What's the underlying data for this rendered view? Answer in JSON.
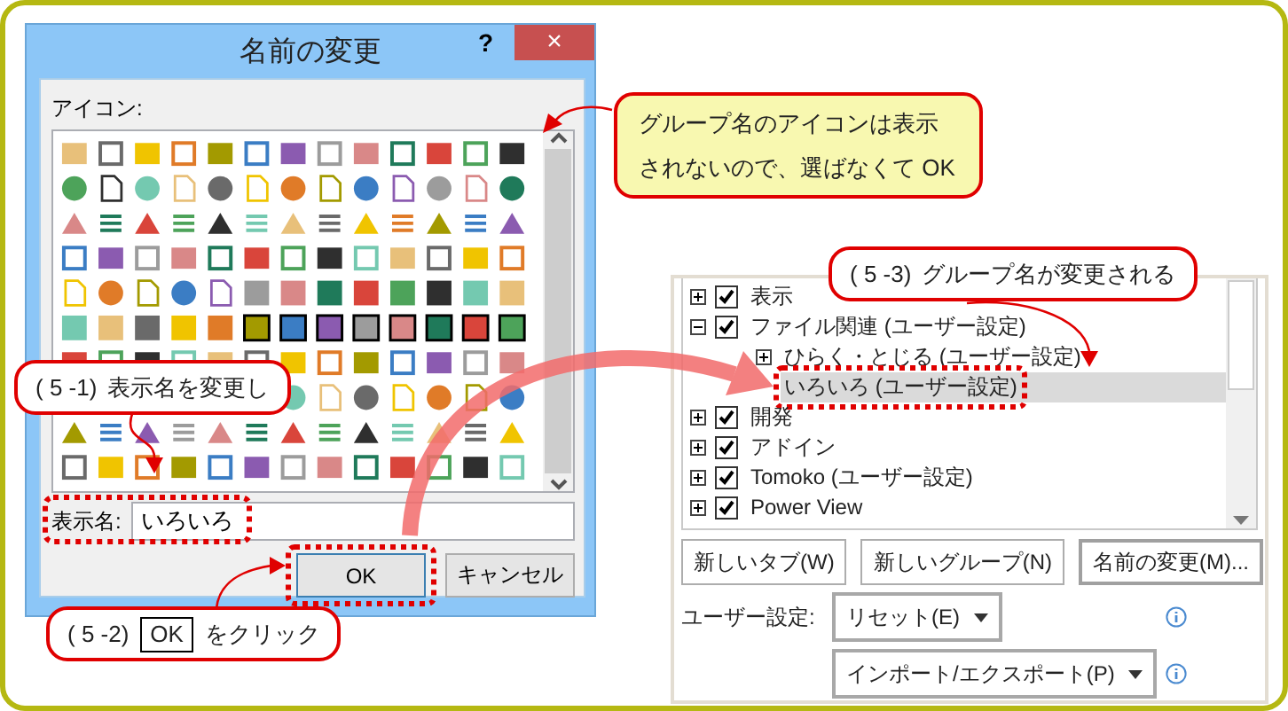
{
  "dialog": {
    "title": "名前の変更",
    "help_button": "?",
    "close_button": "×",
    "icon_label": "アイコン:",
    "name_label": "表示名:",
    "name_value": "いろいろ",
    "name_highlighted": true,
    "buttons": [
      {
        "label": "OK",
        "kind": "default",
        "highlighted": true
      },
      {
        "label": "キャンセル",
        "kind": "normal",
        "highlighted": false
      }
    ]
  },
  "note_callout": {
    "text": "グループ名のアイコンは表示されないので、選ばなくて OK"
  },
  "ribbon": {
    "tree": [
      {
        "label": "表示",
        "checked": true,
        "expanded": false,
        "selected": false
      },
      {
        "label": "ファイル関連 (ユーザー設定)",
        "checked": true,
        "expanded": true,
        "selected": false,
        "children": [
          {
            "label": "ひらく・とじる (ユーザー設定)",
            "expanded": false,
            "selected": false
          },
          {
            "label": "いろいろ (ユーザー設定)",
            "selected": true,
            "highlighted": true
          }
        ]
      },
      {
        "label": "開発",
        "checked": true,
        "expanded": false,
        "selected": false
      },
      {
        "label": "アドイン",
        "checked": true,
        "expanded": false,
        "selected": false
      },
      {
        "label": "Tomoko (ユーザー設定)",
        "checked": true,
        "expanded": false,
        "selected": false
      },
      {
        "label": "Power View",
        "checked": true,
        "expanded": false,
        "selected": false
      }
    ],
    "buttons": [
      "新しいタブ(W)",
      "新しいグループ(N)",
      "名前の変更(M)..."
    ],
    "customize_label": "ユーザー設定:",
    "dropdowns": [
      "リセット(E)",
      "インポート/エクスポート(P)"
    ]
  },
  "step_callouts": [
    {
      "step": "( 5 -1)",
      "text": "表示名を変更し"
    },
    {
      "step": "( 5 -2)",
      "key": "OK",
      "text": "をクリック"
    },
    {
      "step": "( 5 -3)",
      "text": "グループ名が変更される"
    }
  ]
}
